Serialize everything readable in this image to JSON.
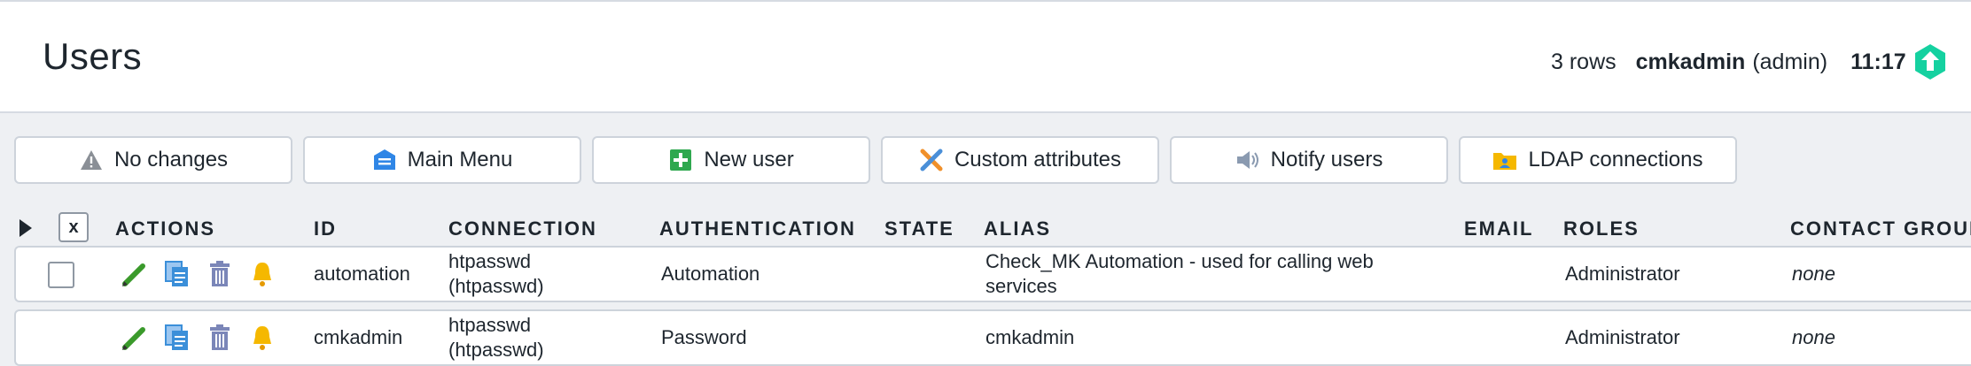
{
  "header": {
    "title": "Users",
    "row_count": "3 rows",
    "user_name": "cmkadmin",
    "user_role": "(admin)",
    "clock": "11:17"
  },
  "toolbar": {
    "buttons": [
      {
        "label": "No changes",
        "icon": "warning-icon"
      },
      {
        "label": "Main Menu",
        "icon": "main-menu-icon"
      },
      {
        "label": "New user",
        "icon": "plus-icon"
      },
      {
        "label": "Custom attributes",
        "icon": "tools-icon"
      },
      {
        "label": "Notify users",
        "icon": "speaker-icon"
      },
      {
        "label": "LDAP connections",
        "icon": "folder-icon"
      }
    ]
  },
  "table": {
    "toggle_all_label": "x",
    "columns": {
      "actions": "ACTIONS",
      "id": "ID",
      "connection": "CONNECTION",
      "authentication": "AUTHENTICATION",
      "state": "STATE",
      "alias": "ALIAS",
      "email": "EMAIL",
      "roles": "ROLES",
      "contact_groups": "CONTACT GROUPS"
    },
    "rows": [
      {
        "id": "automation",
        "connection_line1": "htpasswd",
        "connection_line2": "(htpasswd)",
        "authentication": "Automation",
        "state": "",
        "alias_line1": "Check_MK Automation - used for calling web",
        "alias_line2": "services",
        "email": "",
        "roles": "Administrator",
        "contact_groups": "none",
        "has_checkbox": true
      },
      {
        "id": "cmkadmin",
        "connection_line1": "htpasswd",
        "connection_line2": "(htpasswd)",
        "authentication": "Password",
        "state": "",
        "alias_line1": "cmkadmin",
        "alias_line2": "",
        "email": "",
        "roles": "Administrator",
        "contact_groups": "none",
        "has_checkbox": false
      }
    ]
  },
  "colors": {
    "background": "#eef0f3",
    "header_bg": "#ffffff",
    "text": "#1e262e",
    "border": "#cdd3db",
    "brand_green": "#15d1a0",
    "edit_green": "#3a9a2b",
    "doc_blue": "#3b8fd9",
    "trash_blue": "#7b86b8",
    "bell_yellow": "#f5b800"
  }
}
